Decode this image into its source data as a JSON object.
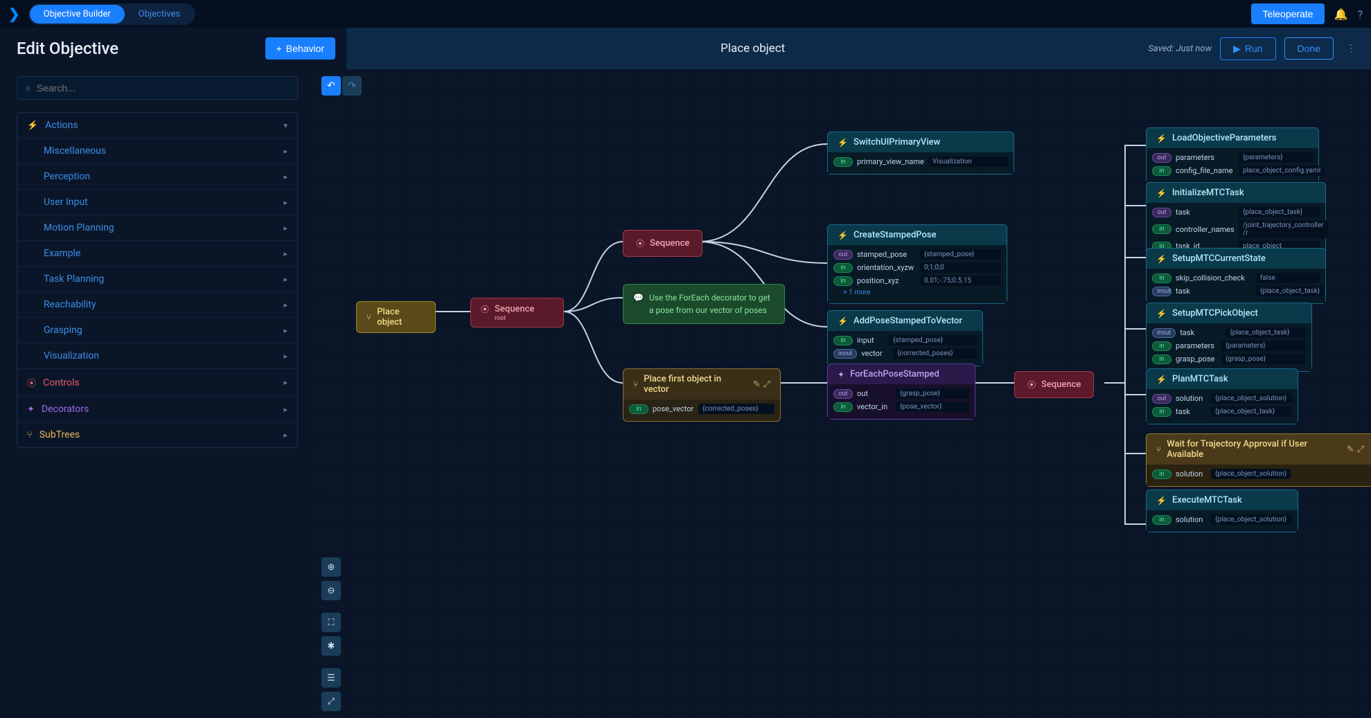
{
  "topbar": {
    "tab1": "Objective Builder",
    "tab2": "Objectives",
    "teleoperate": "Teleoperate"
  },
  "subheader": {
    "edit_title": "Edit Objective",
    "behavior_btn": "Behavior",
    "objective_name": "Place object",
    "saved": "Saved: Just now",
    "run": "Run",
    "done": "Done"
  },
  "sidebar": {
    "search_placeholder": "Search...",
    "actions": "Actions",
    "misc": "Miscellaneous",
    "perception": "Perception",
    "user_input": "User Input",
    "motion": "Motion Planning",
    "example": "Example",
    "task_planning": "Task Planning",
    "reachability": "Reachability",
    "grasping": "Grasping",
    "visualization": "Visualization",
    "controls": "Controls",
    "decorators": "Decorators",
    "subtrees": "SubTrees"
  },
  "nodes": {
    "place_object": "Place object",
    "sequence": "Sequence",
    "sequence_root": "root",
    "comment": "Use the ForEach decorator to get a pose from our vector of poses",
    "switch_ui": {
      "title": "SwitchUIPrimaryView",
      "p1_name": "primary_view_name",
      "p1_val": "Visualization"
    },
    "create_pose": {
      "title": "CreateStampedPose",
      "p1_name": "stamped_pose",
      "p1_val": "{stamped_pose}",
      "p2_name": "orientation_xyzw",
      "p2_val": "0;1;0;0",
      "p3_name": "position_xyz",
      "p3_val": "0.01;-.75;0.5.15",
      "more": "+ 1 more"
    },
    "add_pose": {
      "title": "AddPoseStampedToVector",
      "p1_name": "input",
      "p1_val": "{stamped_pose}",
      "p2_name": "vector",
      "p2_val": "{corrected_poses}"
    },
    "place_first": {
      "title": "Place first object in vector",
      "p1_name": "pose_vector",
      "p1_val": "{corrected_poses}"
    },
    "foreach": {
      "title": "ForEachPoseStamped",
      "p1_name": "out",
      "p1_val": "{grasp_pose}",
      "p2_name": "vector_in",
      "p2_val": "{pose_vector}"
    },
    "load_params": {
      "title": "LoadObjectiveParameters",
      "p1_name": "parameters",
      "p1_val": "{parameters}",
      "p2_name": "config_file_name",
      "p2_val": "place_object_config.yaml"
    },
    "init_mtc": {
      "title": "InitializeMTCTask",
      "p1_name": "task",
      "p1_val": "{place_object_task}",
      "p2_name": "controller_names",
      "p2_val": "/joint_trajectory_controller /r",
      "p3_name": "task_id",
      "p3_val": "place_object"
    },
    "setup_state": {
      "title": "SetupMTCCurrentState",
      "p1_name": "skip_collision_check",
      "p1_val": "false",
      "p2_name": "task",
      "p2_val": "{place_object_task}"
    },
    "setup_pick": {
      "title": "SetupMTCPickObject",
      "p1_name": "task",
      "p1_val": "{place_object_task}",
      "p2_name": "parameters",
      "p2_val": "{parameters}",
      "p3_name": "grasp_pose",
      "p3_val": "{grasp_pose}"
    },
    "plan_mtc": {
      "title": "PlanMTCTask",
      "p1_name": "solution",
      "p1_val": "{place_object_solution}",
      "p2_name": "task",
      "p2_val": "{place_object_task}"
    },
    "wait_approval": {
      "title": "Wait for Trajectory Approval if User Available",
      "p1_name": "solution",
      "p1_val": "{place_object_solution}"
    },
    "execute_mtc": {
      "title": "ExecuteMTCTask",
      "p1_name": "solution",
      "p1_val": "{place_object_solution}"
    }
  }
}
